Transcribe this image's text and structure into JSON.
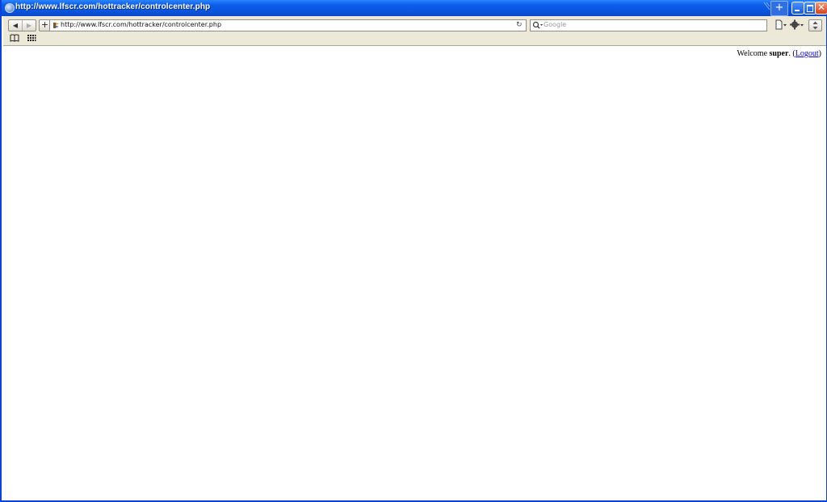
{
  "window": {
    "title": "http://www.lfscr.com/hottracker/controlcenter.php",
    "new_tab_label": "+",
    "close_label": "✕"
  },
  "toolbar": {
    "back_label": "◀",
    "forward_label": "▶",
    "add_label": "+",
    "url": "http://www.lfscr.com/hottracker/controlcenter.php",
    "reload_label": "↻",
    "search_placeholder": "Google"
  },
  "page": {
    "welcome_prefix": "Welcome ",
    "username": "super",
    "separator": ". (",
    "logout_label": "Logout",
    "suffix": ")"
  },
  "colors": {
    "titlebar": "#0a54de",
    "toolbar": "#ece9d8",
    "link": "#0000cc"
  }
}
